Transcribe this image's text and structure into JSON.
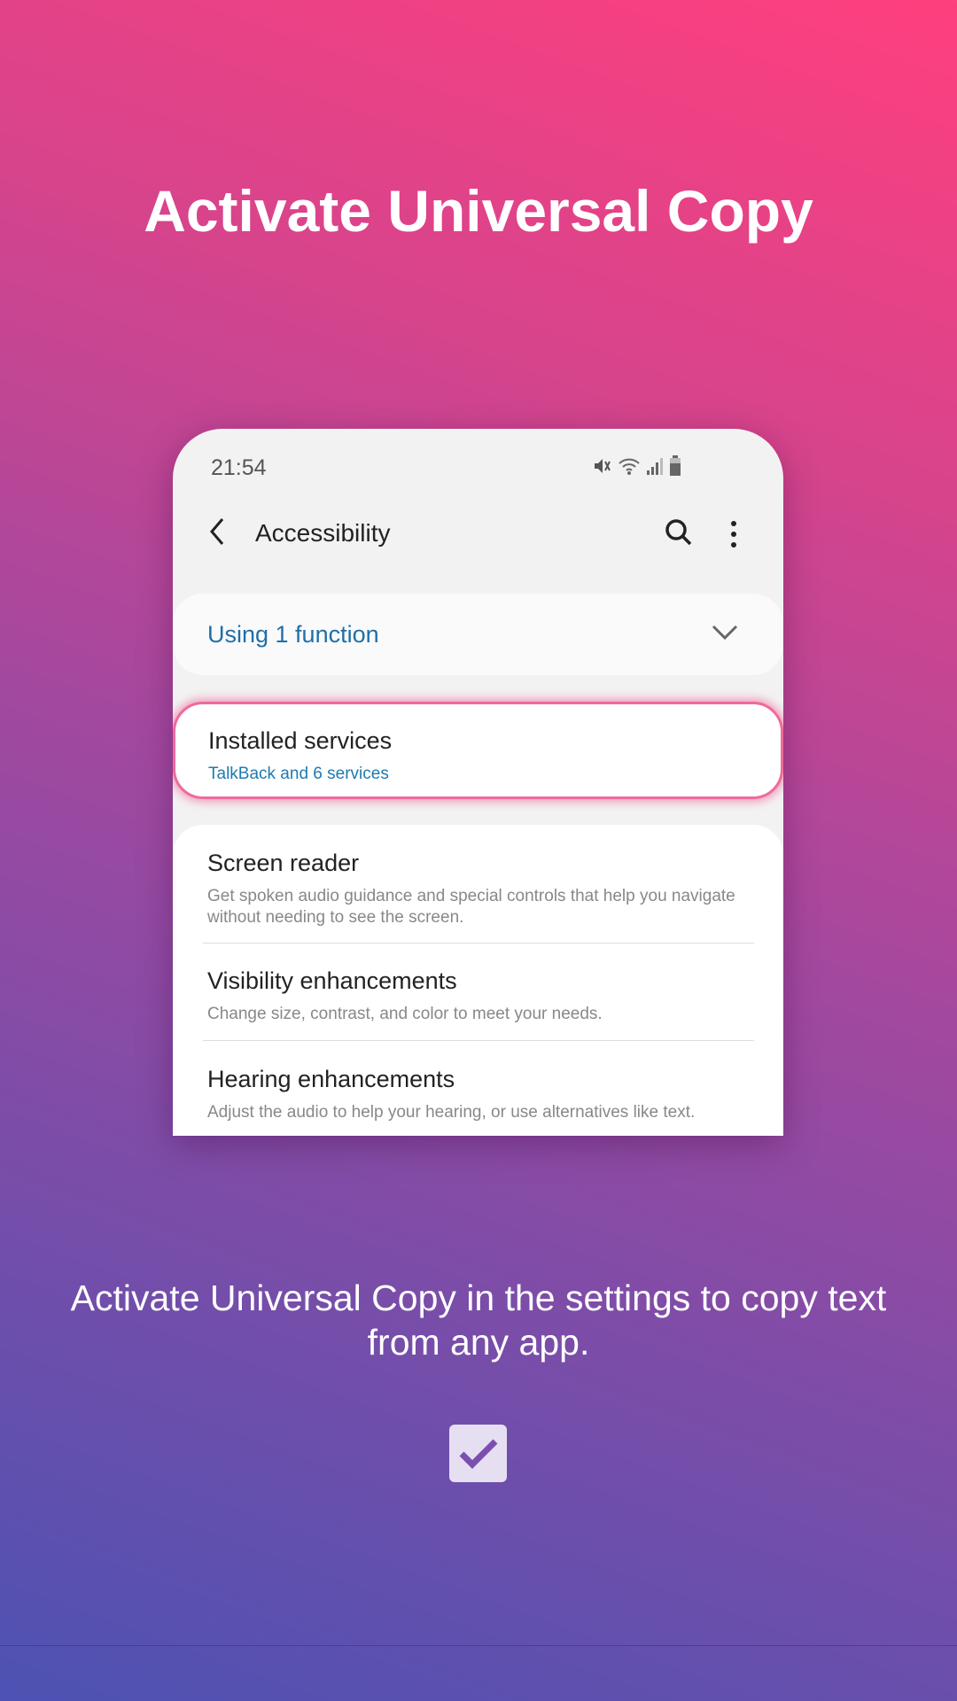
{
  "header": {
    "title": "Activate Universal Copy"
  },
  "phone": {
    "status_bar": {
      "time": "21:54",
      "icons": [
        "mute-icon",
        "wifi-icon",
        "signal-icon",
        "battery-icon"
      ]
    },
    "toolbar": {
      "title": "Accessibility",
      "icons": [
        "back-icon",
        "search-icon",
        "more-icon"
      ]
    },
    "using": {
      "label": "Using 1 function"
    },
    "installed": {
      "title": "Installed services",
      "subtitle": "TalkBack and 6 services"
    },
    "items": [
      {
        "title": "Screen reader",
        "desc": "Get spoken audio guidance and special controls that help you navigate without needing to see the screen."
      },
      {
        "title": "Visibility enhancements",
        "desc": "Change size, contrast, and color to meet your needs."
      },
      {
        "title": "Hearing enhancements",
        "desc": "Adjust the audio to help your hearing, or use alternatives like text."
      }
    ],
    "highlight_color": "#f06a9c",
    "accent_color": "#1f6fa8"
  },
  "caption": "Activate Universal Copy in the settings to copy text from any app.",
  "checkbox": {
    "checked": true
  }
}
